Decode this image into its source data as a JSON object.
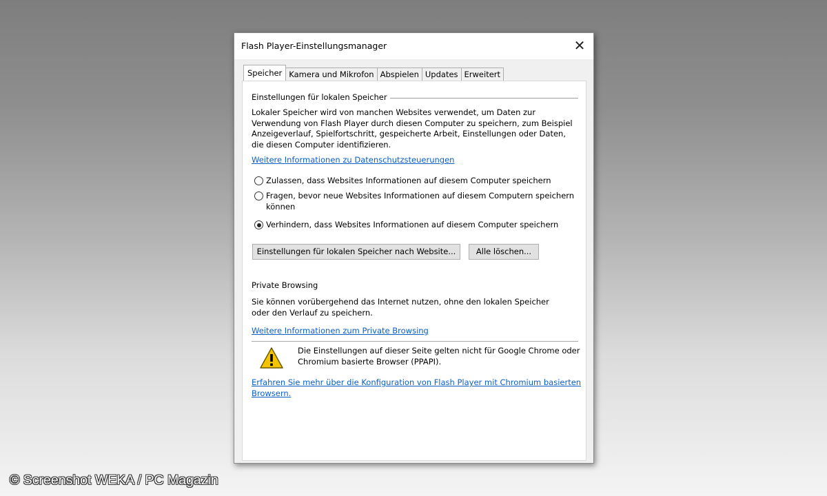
{
  "window": {
    "title": "Flash Player-Einstellungsmanager",
    "close_icon": "close-icon"
  },
  "tabs": [
    {
      "label": "Speicher",
      "active": true
    },
    {
      "label": "Kamera und Mikrofon",
      "active": false
    },
    {
      "label": "Abspielen",
      "active": false
    },
    {
      "label": "Updates",
      "active": false
    },
    {
      "label": "Erweitert",
      "active": false
    }
  ],
  "local_storage": {
    "heading": "Einstellungen für lokalen Speicher",
    "description_lines": [
      "Lokaler Speicher wird von manchen Websites verwendet, um Daten zur",
      "Verwendung von Flash Player durch diesen Computer zu speichern, zum Beispiel",
      "Anzeigeverlauf, Spielfortschritt, gespeicherte Arbeit, Einstellungen oder Daten,",
      "die diesen Computer identifizieren."
    ],
    "privacy_link": "Weitere Informationen zu Datenschutzsteuerungen",
    "options": [
      {
        "lines": [
          "Zulassen, dass Websites Informationen auf diesem Computer speichern"
        ],
        "checked": false
      },
      {
        "lines": [
          "Fragen, bevor neue Websites Informationen auf diesem Computern speichern",
          "können"
        ],
        "checked": false
      },
      {
        "lines": [
          "Verhindern, dass Websites Informationen auf diesem Computer speichern"
        ],
        "checked": true
      }
    ],
    "per_site_button": "Einstellungen für lokalen Speicher  nach Website...",
    "delete_all_button": "Alle löschen..."
  },
  "private_browsing": {
    "heading": "Private Browsing",
    "description_lines": [
      "Sie können vorübergehend das Internet nutzen, ohne den lokalen Speicher",
      "oder den Verlauf zu speichern."
    ],
    "link": "Weitere Informationen zum Private Browsing"
  },
  "notice": {
    "icon": "warning-icon",
    "text_lines": [
      "Die Einstellungen auf dieser Seite gelten nicht für Google Chrome oder",
      "Chromium basierte Browser (PPAPI)."
    ],
    "link_lines": [
      "Erfahren Sie mehr über die Konfiguration von Flash Player mit Chromium basierten",
      "Browsern."
    ]
  },
  "watermark": "© Screenshot WEKA / PC Magazin",
  "colors": {
    "link": "#0b5fc4",
    "warning_yellow": "#f5c400",
    "panel_bg": "#ffffff",
    "dialog_bg": "#f0f0f0"
  }
}
